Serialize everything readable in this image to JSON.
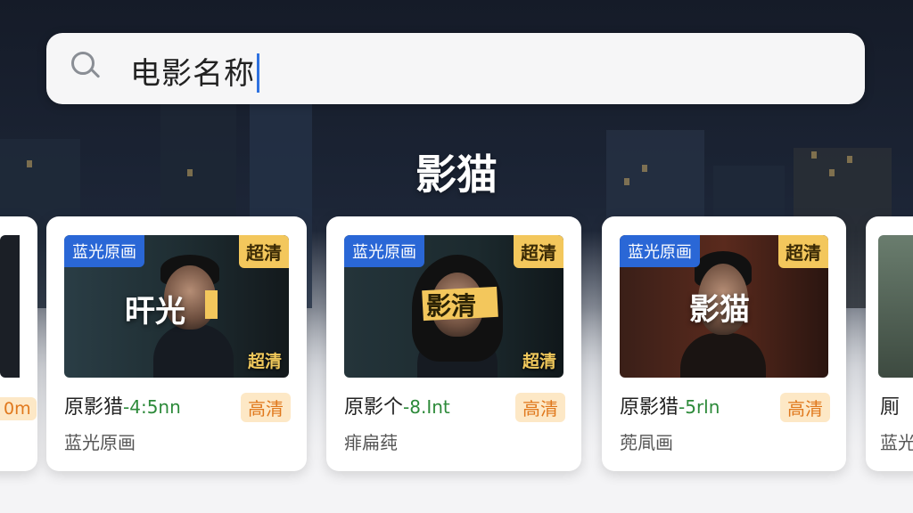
{
  "search": {
    "value": "电影名称",
    "icon": "search-icon"
  },
  "brand": "影猫",
  "left_partial": {
    "tag": "0m"
  },
  "cards": [
    {
      "badge_left": "蓝光原画",
      "badge_right": "超清",
      "poster_title": "旰光",
      "poster_hd": "超清",
      "title": "原影猎",
      "suffix": "-4:5nn",
      "tag": "高清",
      "subtitle": "蓝光原画"
    },
    {
      "badge_left": "蓝光原画",
      "badge_right": "超清",
      "poster_title": "影清",
      "poster_hd": "超清",
      "title": "原影个",
      "suffix": "-8.Int",
      "tag": "高清",
      "subtitle": "痱扁莼"
    },
    {
      "badge_left": "蓝光原画",
      "badge_right": "超清",
      "poster_title": "影猫",
      "poster_hd": "",
      "title": "原影猎",
      "suffix": "-5rln",
      "tag": "高清",
      "subtitle": "蔸凬画"
    }
  ],
  "right_partial": {
    "title": "厠",
    "subtitle": "蓝光"
  }
}
